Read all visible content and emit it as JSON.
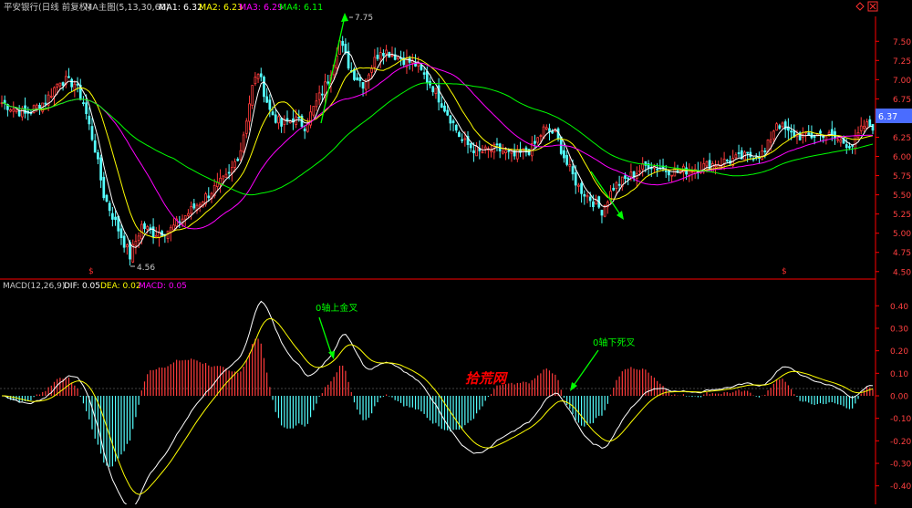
{
  "header": {
    "title": "平安银行(日线 前复权)",
    "ma_label": "MA主图(5,13,30,60)",
    "ma1": "MA1: 6.32",
    "ma2": "MA2: 6.23",
    "ma3": "MA3: 6.29",
    "ma4": "MA4: 6.11",
    "corner_icon": "diamond-icon",
    "close_icon": "close-icon"
  },
  "macd_header": {
    "label": "MACD(12,26,9)",
    "dif": "DIF: 0.05",
    "dea": "DEA: 0.02",
    "macd": "MACD: 0.05"
  },
  "colors": {
    "up": "#ff3b3b",
    "down": "#54ffff",
    "ma1": "#ffffff",
    "ma2": "#ffff00",
    "ma3": "#ff00ff",
    "ma4": "#00ff00",
    "axis": "#ff0000",
    "annotation": "#00ff00",
    "watermark": "#ff0000",
    "price_tag": "#4a6cff"
  },
  "annotations": {
    "high_label": "7.75",
    "low_label": "4.56",
    "current_price": "6.37",
    "golden_cross": "0轴上金叉",
    "death_cross": "0轴下死叉",
    "watermark": "拾荒网",
    "marker_left": "$",
    "marker_right": "$"
  },
  "chart_data": [
    {
      "type": "candlestick",
      "title": "平安银行(日线 前复权)",
      "series_names": [
        "MA1",
        "MA2",
        "MA3",
        "MA4"
      ],
      "y_ticks": [
        "7.50",
        "7.25",
        "7.00",
        "6.75",
        "6.50",
        "6.25",
        "6.00",
        "5.75",
        "5.50",
        "5.25",
        "5.00",
        "4.75",
        "4.50"
      ],
      "y_values": [
        7.5,
        7.25,
        7.0,
        6.75,
        6.5,
        6.25,
        6.0,
        5.75,
        5.5,
        5.25,
        5.0,
        4.75,
        4.5
      ],
      "ylim": [
        4.45,
        7.8
      ],
      "high": 7.75,
      "low": 4.56,
      "last": 6.37,
      "close_keypoints": [
        [
          0,
          6.7
        ],
        [
          8,
          6.55
        ],
        [
          15,
          6.72
        ],
        [
          20,
          7.0
        ],
        [
          25,
          6.95
        ],
        [
          28,
          6.7
        ],
        [
          32,
          6.1
        ],
        [
          35,
          5.5
        ],
        [
          40,
          5.05
        ],
        [
          44,
          4.7
        ],
        [
          48,
          5.1
        ],
        [
          52,
          5.0
        ],
        [
          58,
          5.05
        ],
        [
          65,
          5.3
        ],
        [
          72,
          5.55
        ],
        [
          78,
          5.75
        ],
        [
          82,
          6.1
        ],
        [
          86,
          6.9
        ],
        [
          88,
          7.1
        ],
        [
          92,
          6.6
        ],
        [
          96,
          6.4
        ],
        [
          100,
          6.5
        ],
        [
          104,
          6.4
        ],
        [
          108,
          6.7
        ],
        [
          112,
          7.0
        ],
        [
          116,
          7.5
        ],
        [
          120,
          7.1
        ],
        [
          124,
          6.95
        ],
        [
          130,
          7.4
        ],
        [
          136,
          7.3
        ],
        [
          142,
          7.2
        ],
        [
          148,
          6.9
        ],
        [
          154,
          6.5
        ],
        [
          158,
          6.2
        ],
        [
          164,
          6.05
        ],
        [
          170,
          6.1
        ],
        [
          176,
          6.0
        ],
        [
          182,
          6.1
        ],
        [
          186,
          6.35
        ],
        [
          190,
          6.3
        ],
        [
          194,
          5.9
        ],
        [
          198,
          5.6
        ],
        [
          202,
          5.45
        ],
        [
          206,
          5.3
        ],
        [
          210,
          5.6
        ],
        [
          216,
          5.75
        ],
        [
          222,
          5.9
        ],
        [
          226,
          5.85
        ],
        [
          232,
          5.8
        ],
        [
          238,
          5.85
        ],
        [
          244,
          5.9
        ],
        [
          250,
          5.95
        ],
        [
          256,
          6.0
        ],
        [
          262,
          6.05
        ],
        [
          266,
          6.45
        ],
        [
          270,
          6.3
        ],
        [
          276,
          6.25
        ],
        [
          282,
          6.3
        ],
        [
          288,
          6.2
        ],
        [
          292,
          6.15
        ],
        [
          296,
          6.4
        ]
      ]
    },
    {
      "type": "macd",
      "title": "MACD(12,26,9)",
      "series_names": [
        "DIF",
        "DEA",
        "MACD"
      ],
      "y_ticks": [
        "0.40",
        "0.30",
        "0.20",
        "0.10",
        "0.00",
        "-0.10",
        "-0.20",
        "-0.30",
        "-0.40"
      ],
      "y_values": [
        0.4,
        0.3,
        0.2,
        0.1,
        0.0,
        -0.1,
        -0.2,
        -0.3,
        -0.4
      ],
      "ylim": [
        -0.47,
        0.47
      ],
      "dif_last": 0.05,
      "dea_last": 0.02,
      "macd_last": 0.05
    }
  ]
}
